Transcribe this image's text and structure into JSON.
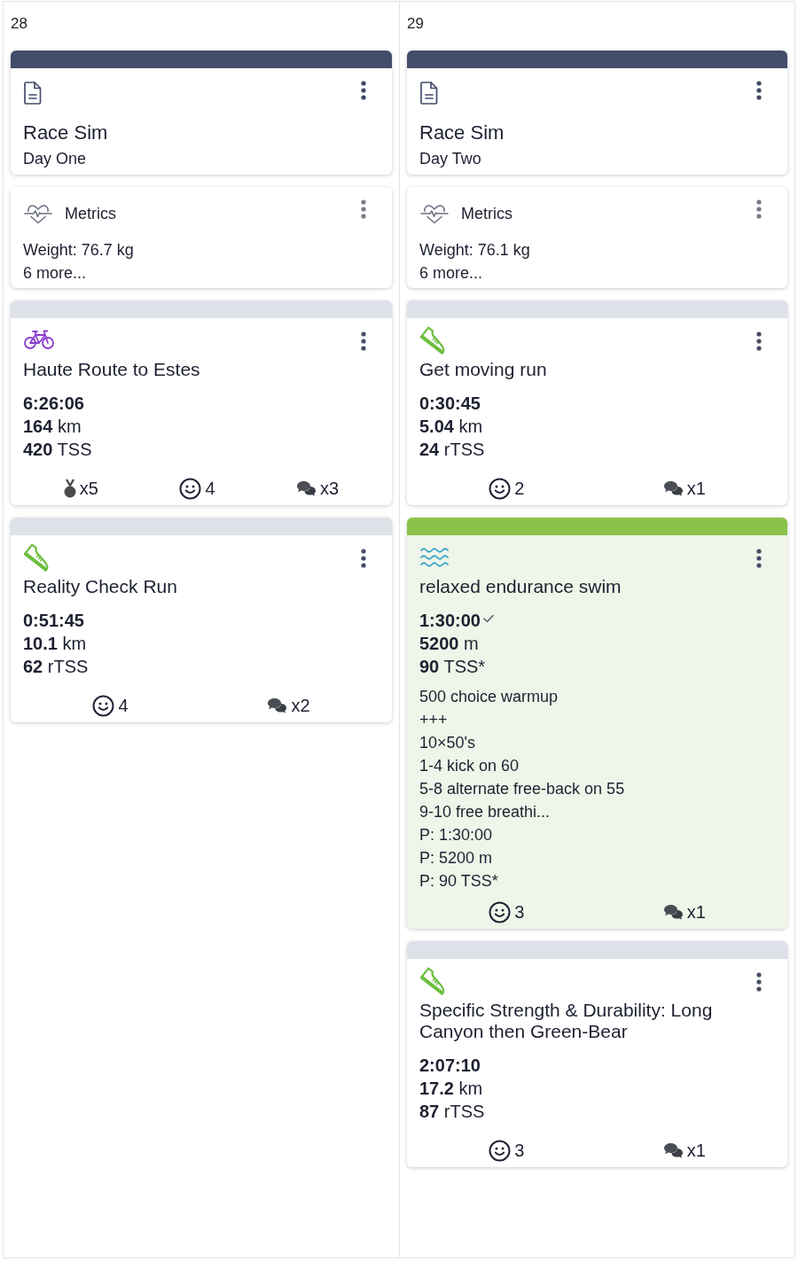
{
  "days": [
    {
      "date": "28",
      "cards": [
        {
          "kind": "note",
          "color": "#434d6b",
          "title": "Race Sim",
          "subtitle": "Day One"
        },
        {
          "kind": "metrics",
          "title": "Metrics",
          "lines": [
            "Weight: 76.7 kg",
            "6 more..."
          ]
        },
        {
          "kind": "bike",
          "color": "#dfe1e8",
          "highlighted": false,
          "title": "Haute Route to Estes",
          "duration_checked": false,
          "stats": [
            {
              "kind": "duration",
              "value": "6:26:06"
            },
            {
              "kind": "distance",
              "value": "164",
              "unit": "km"
            },
            {
              "kind": "load",
              "value": "420",
              "unit": "TSS"
            }
          ],
          "footer": [
            {
              "kind": "medals",
              "text": "x5"
            },
            {
              "kind": "feel",
              "text": "4"
            },
            {
              "kind": "comments",
              "text": "x3"
            }
          ]
        },
        {
          "kind": "run",
          "color": "#dfe1e8",
          "highlighted": false,
          "title": "Reality Check Run",
          "duration_checked": false,
          "stats": [
            {
              "kind": "duration",
              "value": "0:51:45"
            },
            {
              "kind": "distance",
              "value": "10.1",
              "unit": "km"
            },
            {
              "kind": "load",
              "value": "62",
              "unit": "rTSS"
            }
          ],
          "footer": [
            {
              "kind": "feel",
              "text": "4"
            },
            {
              "kind": "comments",
              "text": "x2"
            }
          ]
        }
      ]
    },
    {
      "date": "29",
      "cards": [
        {
          "kind": "note",
          "color": "#434d6b",
          "title": "Race Sim",
          "subtitle": "Day Two"
        },
        {
          "kind": "metrics",
          "title": "Metrics",
          "lines": [
            "Weight: 76.1 kg",
            "6 more..."
          ]
        },
        {
          "kind": "run",
          "color": "#dfe1e8",
          "highlighted": false,
          "title": "Get moving run",
          "duration_checked": false,
          "stats": [
            {
              "kind": "duration",
              "value": "0:30:45"
            },
            {
              "kind": "distance",
              "value": "5.04",
              "unit": "km"
            },
            {
              "kind": "load",
              "value": "24",
              "unit": "rTSS"
            }
          ],
          "footer": [
            {
              "kind": "feel",
              "text": "2"
            },
            {
              "kind": "comments",
              "text": "x1"
            }
          ]
        },
        {
          "kind": "swim",
          "color": "#8bc34a",
          "highlighted": true,
          "title": "relaxed endurance swim",
          "duration_checked": true,
          "stats": [
            {
              "kind": "duration",
              "value": "1:30:00"
            },
            {
              "kind": "distance",
              "value": "5200",
              "unit": "m"
            },
            {
              "kind": "load",
              "value": "90",
              "unit": "TSS*"
            }
          ],
          "description": [
            "500 choice warmup",
            "+++",
            "10×50's",
            "1-4 kick on 60",
            "5-8 alternate free-back on 55",
            "9-10 free breathi..."
          ],
          "planned": [
            "P: 1:30:00",
            "P: 5200 m",
            "P: 90 TSS*"
          ],
          "footer": [
            {
              "kind": "feel",
              "text": "3"
            },
            {
              "kind": "comments",
              "text": "x1"
            }
          ]
        },
        {
          "kind": "run",
          "color": "#dfe1e8",
          "highlighted": false,
          "title": "Specific Strength & Durability: Long Canyon then Green-Bear",
          "duration_checked": false,
          "stats": [
            {
              "kind": "duration",
              "value": "2:07:10"
            },
            {
              "kind": "distance",
              "value": "17.2",
              "unit": "km"
            },
            {
              "kind": "load",
              "value": "87",
              "unit": "rTSS"
            }
          ],
          "footer": [
            {
              "kind": "feel",
              "text": "3"
            },
            {
              "kind": "comments",
              "text": "x1"
            }
          ]
        }
      ]
    }
  ]
}
